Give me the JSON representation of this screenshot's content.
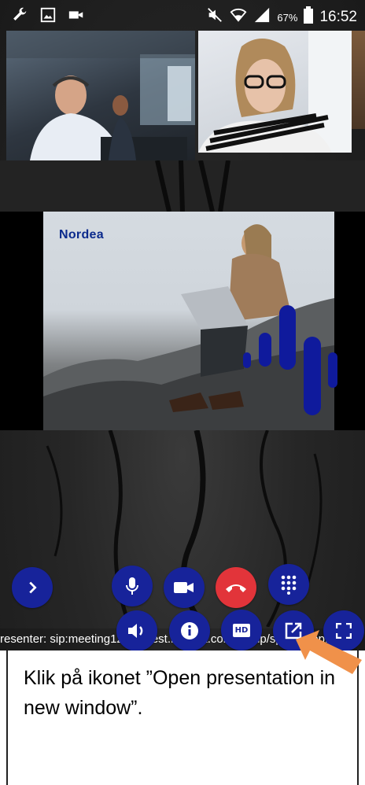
{
  "status_bar": {
    "battery": "67%",
    "time": "16:52",
    "left_icons": [
      "wrench-icon",
      "image-icon",
      "video-icon"
    ],
    "right_icons": [
      "mute-icon",
      "wifi-icon",
      "signal-icon",
      "battery-icon"
    ]
  },
  "presentation": {
    "logo": "Nordea"
  },
  "controls": {
    "row1": [
      "expand-chevron-icon",
      "microphone-icon",
      "camera-icon",
      "hangup-icon",
      "dialpad-icon"
    ],
    "row2": [
      "speaker-icon",
      "info-icon",
      "hd-icon",
      "open-window-icon",
      "fullscreen-icon"
    ],
    "hd_label": "HD"
  },
  "presenter": {
    "text": "resenter: sip:meeting1234@test.nordea.com/group/space-app.c"
  },
  "instruction": {
    "text": "Klik på ikonet ”Open presentation in new window”."
  },
  "colors": {
    "button_blue": "#17239a",
    "hangup_red": "#e2343a",
    "arrow_orange": "#f0914a",
    "brand_blue": "#0b2a8c"
  }
}
